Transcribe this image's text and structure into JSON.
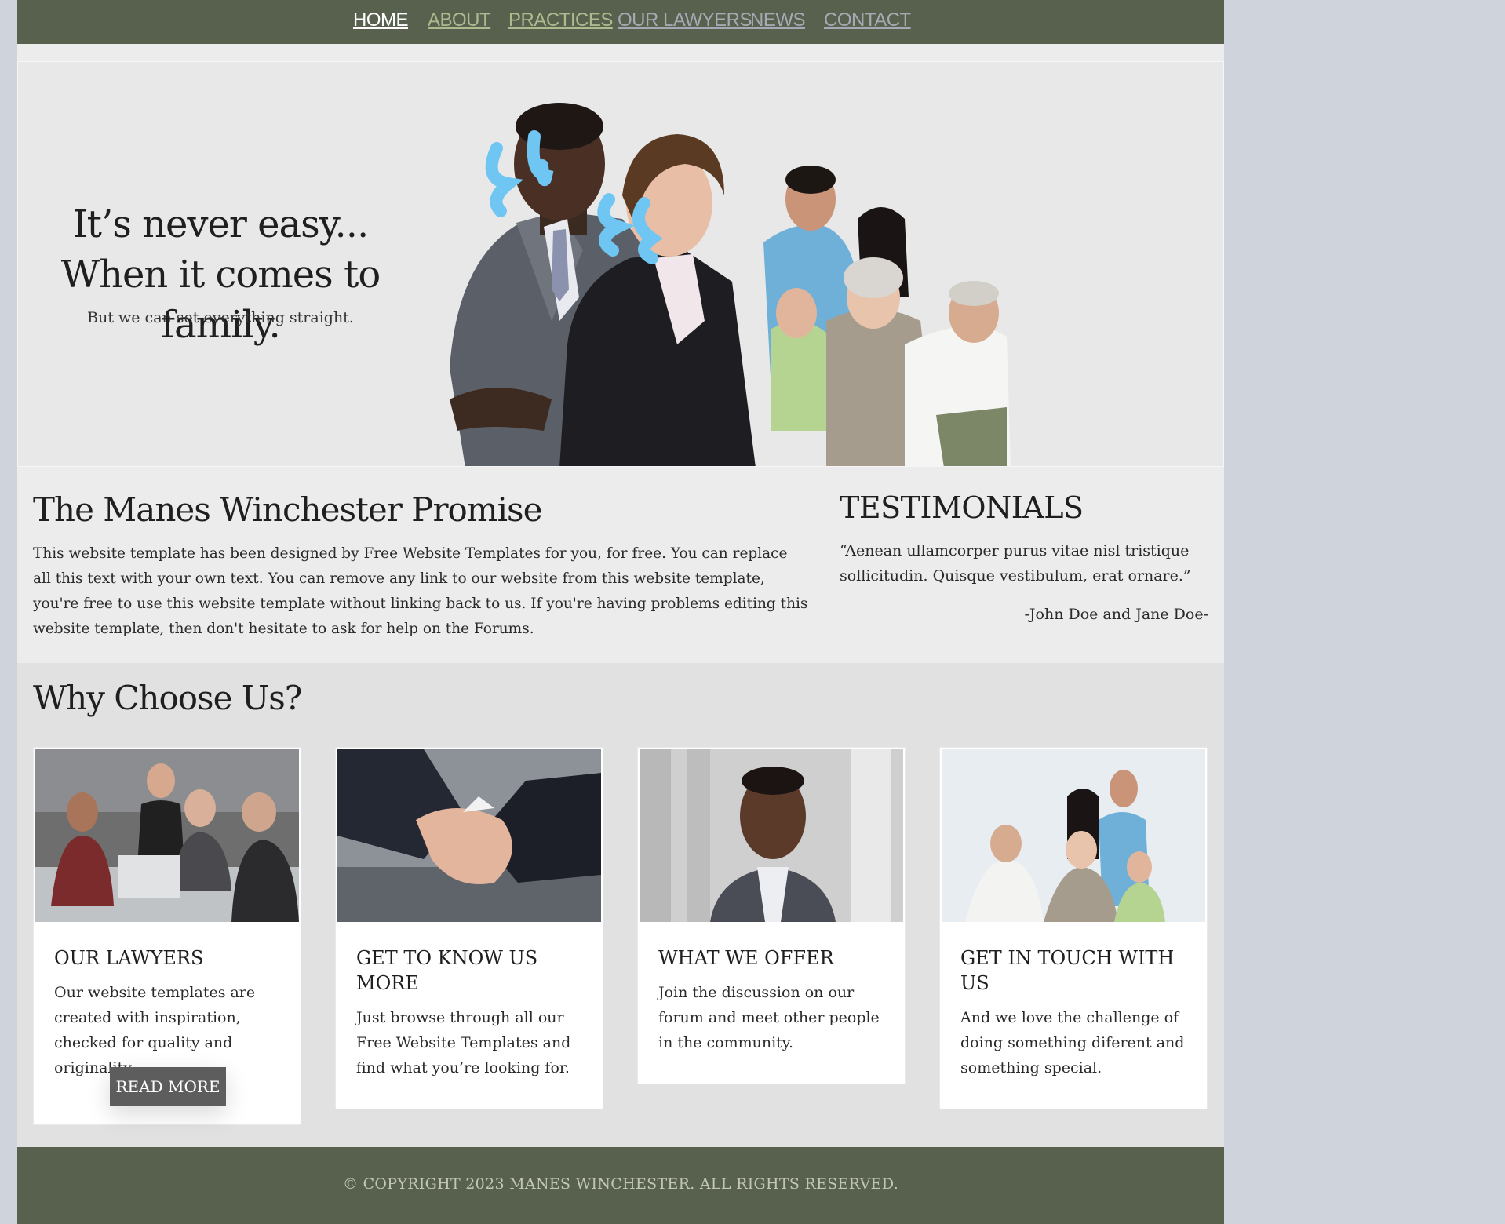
{
  "nav": {
    "items": [
      {
        "label": "HOME"
      },
      {
        "label": "ABOUT"
      },
      {
        "label": "PRACTICES"
      },
      {
        "label": "OUR LAWYERS"
      },
      {
        "label": "NEWS"
      },
      {
        "label": "CONTACT"
      }
    ],
    "active": "HOME"
  },
  "hero": {
    "title": "It’s never easy... When it comes to family.",
    "subtitle": "But we can set everything straight."
  },
  "promise": {
    "title": "The Manes Winchester Promise",
    "text": "This website template has been designed by Free Website Templates for you, for free. You can replace all this text with your own text. You can remove any link to our website from this website template, you're free to use this website template without linking back to us. If you're having problems editing this website template, then don't hesitate to ask for help on the Forums."
  },
  "testimonials": {
    "title": "TESTIMONIALS",
    "quote": "“Aenean ullamcorper purus vitae nisl tristique sollicitudin. Quisque vestibulum, erat ornare.”",
    "author": "-John Doe and Jane Doe-"
  },
  "why": {
    "title": "Why Choose Us?",
    "cards": [
      {
        "title": "OUR LAWYERS",
        "text": "Our website templates are created with inspiration, checked for quality and originality.",
        "button": "READ MORE"
      },
      {
        "title": "GET TO KNOW US MORE",
        "text": "Just browse through all our Free Website Templates and find what you’re looking for."
      },
      {
        "title": "WHAT WE OFFER",
        "text": "Join the discussion on our forum and meet other people in the community."
      },
      {
        "title": "GET IN TOUCH WITH US",
        "text": "And we love the challenge of doing something diferent and something special."
      }
    ]
  },
  "footer": {
    "copyright": "© COPYRIGHT 2023 MANES WINCHESTER. ALL RIGHTS RESERVED."
  },
  "colors": {
    "nav_bg": "#58614d",
    "nav_link": "#aeb98f",
    "nav_active": "#ffffff",
    "button_bg": "#5d5d5d",
    "page_bg": "#cfd3db"
  },
  "images": {
    "hero": "lawyers-and-family-photo",
    "card1": "business-meeting-photo",
    "card2": "handshake-photo",
    "card3": "businessman-portrait-photo",
    "card4": "family-group-photo"
  }
}
